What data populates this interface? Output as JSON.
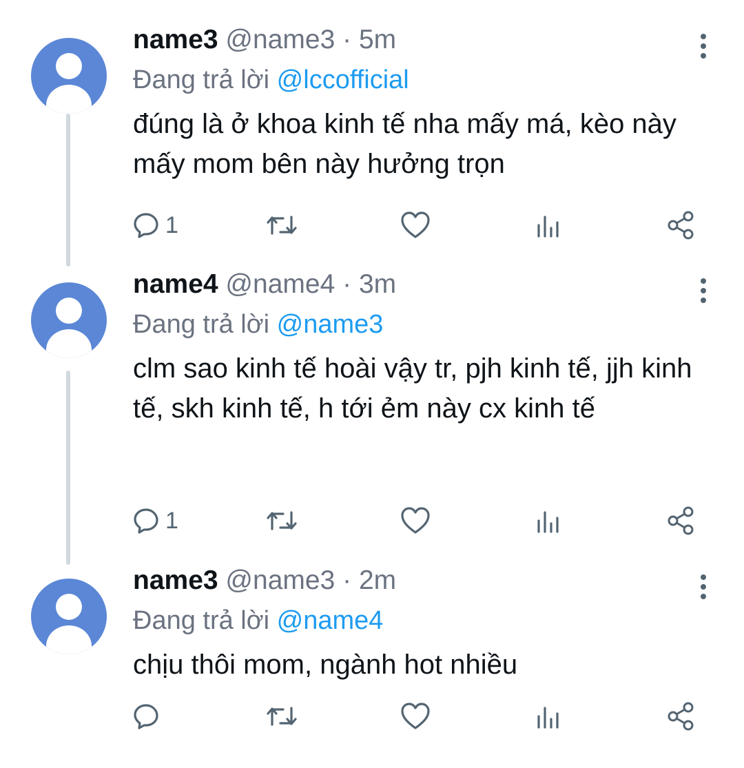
{
  "tweets": [
    {
      "name": "name3",
      "handle": "@name3",
      "separator": "·",
      "time": "5m",
      "reply_prefix": "Đang trả lời",
      "reply_to": "@lccofficial",
      "text": "đúng là ở khoa kinh tế nha mấy má, kèo này mấy mom bên này hưởng trọn",
      "reply_count": "1"
    },
    {
      "name": "name4",
      "handle": "@name4",
      "separator": "·",
      "time": "3m",
      "reply_prefix": "Đang trả lời",
      "reply_to": "@name3",
      "text": "clm sao kinh tế hoài vậy tr, pjh kinh tế, jjh kinh tế, skh kinh tế, h tới ẻm này cx kinh tế",
      "reply_count": "1"
    },
    {
      "name": "name3",
      "handle": "@name3",
      "separator": "·",
      "time": "2m",
      "reply_prefix": "Đang trả lời",
      "reply_to": "@name4",
      "text": "chịu thôi mom, ngành hot nhiều",
      "reply_count": ""
    }
  ],
  "icons": {
    "reply": "reply-icon",
    "retweet": "retweet-icon",
    "like": "heart-icon",
    "views": "analytics-icon",
    "share": "share-icon",
    "more": "more-vertical-icon"
  },
  "colors": {
    "avatar": "#5b87d6",
    "mention": "#1d9bf0",
    "muted": "#6b7280",
    "thread_line": "#cfd9de"
  }
}
